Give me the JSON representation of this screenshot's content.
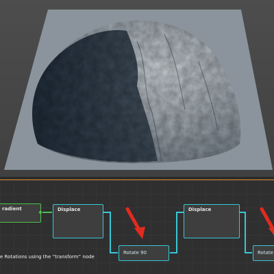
{
  "viewport": {
    "subject_icon": "terrain-heightmap-render"
  },
  "graph": {
    "nodes": [
      {
        "id": "gradient",
        "label": "radient",
        "color": "#4ec24e"
      },
      {
        "id": "displace-1",
        "label": "Displace",
        "color": "#37c9d8"
      },
      {
        "id": "rotate-1",
        "label": "Rotate 90",
        "color": "#37c9d8"
      },
      {
        "id": "displace-2",
        "label": "Displace",
        "color": "#37c9d8"
      },
      {
        "id": "rotate-2",
        "label": "Rotate -",
        "color": "#37c9d8"
      }
    ],
    "annotation_arrow_color": "#e02b20",
    "caption": "e Rotations using the “transform” node"
  },
  "colors": {
    "wire": "#37c9d8",
    "wire_green": "#4ec24e",
    "divider_accent": "#e08a2a"
  }
}
